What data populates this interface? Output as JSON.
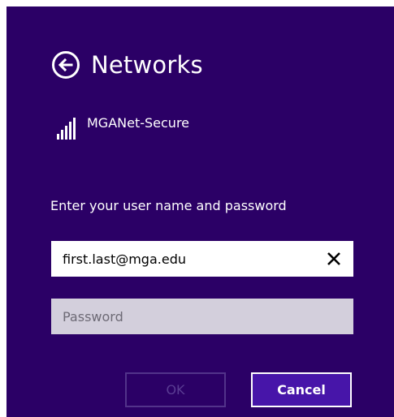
{
  "header": {
    "title": "Networks",
    "back_icon": "arrow-left-circle-icon"
  },
  "network": {
    "name": "MGANet-Secure",
    "signal_icon": "wifi-signal-icon"
  },
  "form": {
    "prompt": "Enter your user name and password",
    "username_value": "first.last@mga.edu",
    "password_placeholder": "Password",
    "clear_icon": "close-icon"
  },
  "buttons": {
    "ok_label": "OK",
    "cancel_label": "Cancel"
  },
  "colors": {
    "background": "#2b0066",
    "accent": "#4715a9",
    "password_bg": "#d3cfdc"
  }
}
